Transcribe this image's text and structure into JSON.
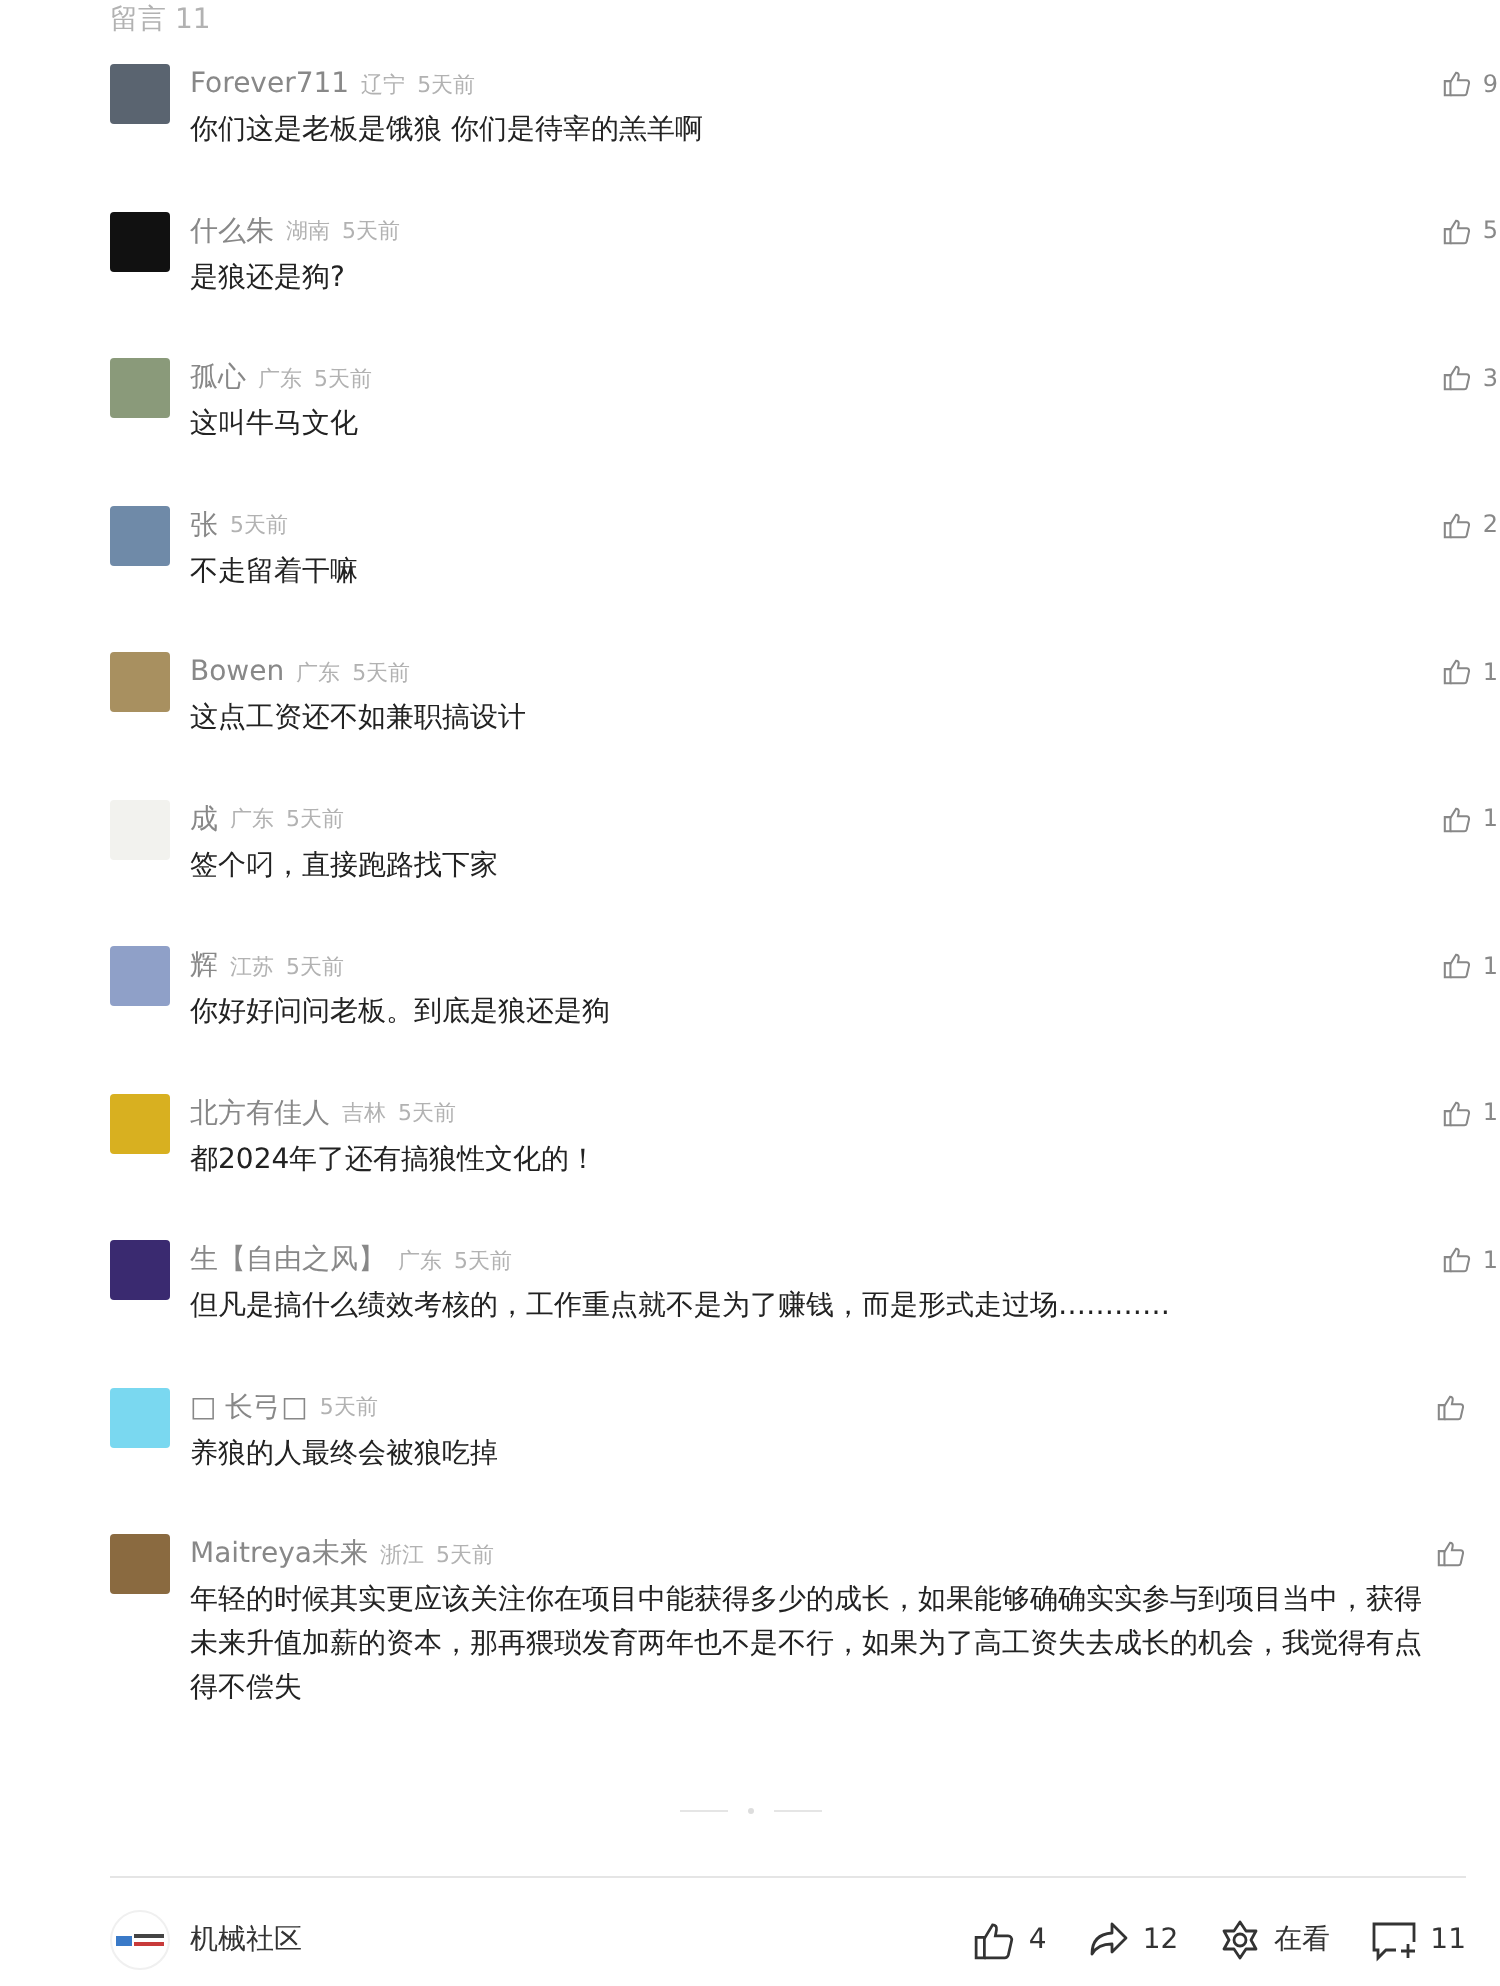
{
  "header": {
    "title": "留言 11"
  },
  "comments": [
    {
      "name": "Forever711",
      "region": "辽宁",
      "time": "5天前",
      "text": "你们这是老板是饿狼 你们是待宰的羔羊啊",
      "likes": "9"
    },
    {
      "name": "什么朱",
      "region": "湖南",
      "time": "5天前",
      "text": "是狼还是狗?",
      "likes": "5"
    },
    {
      "name": "孤心",
      "region": "广东",
      "time": "5天前",
      "text": "这叫牛马文化",
      "likes": "3"
    },
    {
      "name": "张",
      "time": "5天前",
      "text": "不走留着干嘛",
      "likes": "2"
    },
    {
      "name": "Bowen",
      "region": "广东",
      "time": "5天前",
      "text": "这点工资还不如兼职搞设计",
      "likes": "1"
    },
    {
      "name": "成",
      "region": "广东",
      "time": "5天前",
      "text": "签个叼，直接跑路找下家",
      "likes": "1"
    },
    {
      "name": "辉",
      "region": "江苏",
      "time": "5天前",
      "text": "你好好问问老板。到底是狼还是狗",
      "likes": "1"
    },
    {
      "name": "北方有佳人",
      "region": "吉林",
      "time": "5天前",
      "text": "都2024年了还有搞狼性文化的！",
      "likes": "1"
    },
    {
      "name": "生【自由之风】",
      "region": "广东",
      "time": "5天前",
      "text": "但凡是搞什么绩效考核的，工作重点就不是为了赚钱，而是形式走过场…………",
      "likes": "1"
    },
    {
      "name": "□ 长弓□",
      "time": "5天前",
      "text": "养狼的人最终会被狼吃掉"
    },
    {
      "name": "Maitreya未来",
      "region": "浙江",
      "time": "5天前",
      "text": "年轻的时候其实更应该关注你在项目中能获得多少的成长，如果能够确确实实参与到项目当中，获得未来升值加薪的资本，那再猥琐发育两年也不是不行，如果为了高工资失去成长的机会，我觉得有点得不偿失"
    }
  ],
  "footer": {
    "account": "机械社区",
    "likes": "4",
    "shares": "12",
    "watching": "在看",
    "comments": "11"
  }
}
